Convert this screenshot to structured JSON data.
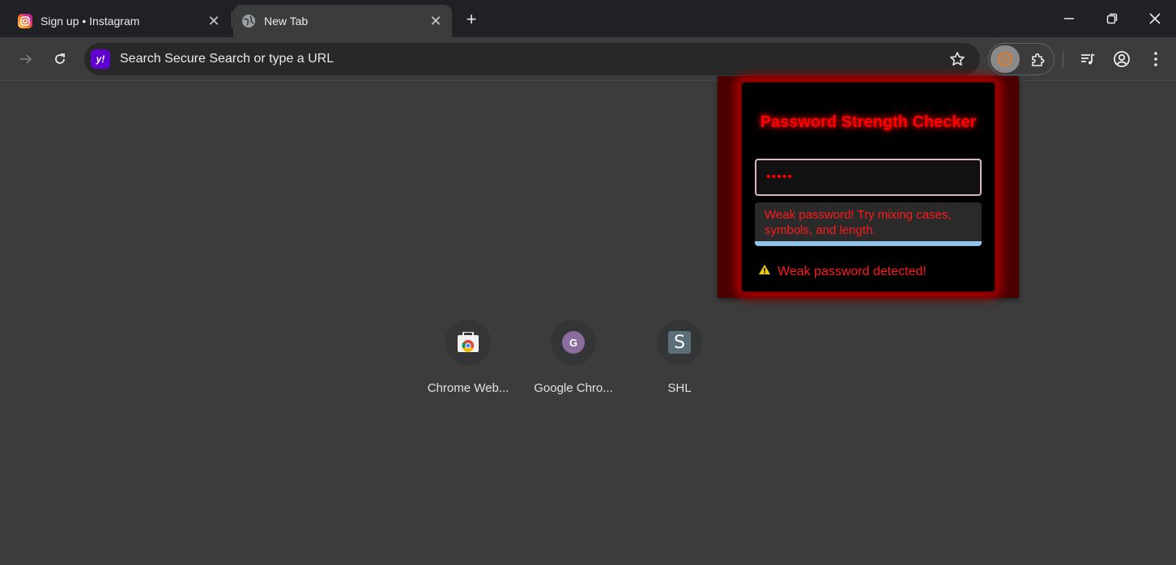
{
  "tabs": [
    {
      "title": "Sign up • Instagram",
      "close": "✕",
      "favicon": "instagram-icon"
    },
    {
      "title": "New Tab",
      "close": "✕",
      "favicon": "globe-icon"
    }
  ],
  "new_tab_symbol": "+",
  "window_controls": {
    "minimize": "minimize-icon",
    "restore": "restore-icon",
    "close": "close-icon"
  },
  "toolbar": {
    "omnibox_placeholder": "Search Secure Search or type a URL",
    "search_engine_logo": "y!"
  },
  "shortcuts": [
    {
      "label": "Chrome Web...",
      "icon": "chrome-web-store-icon"
    },
    {
      "label": "Google Chro...",
      "icon": "letter-g-icon",
      "letter": "G"
    },
    {
      "label": "SHL",
      "icon": "shl-icon",
      "letter": "S"
    }
  ],
  "popup": {
    "title": "Password Strength Checker",
    "password_value": "•••••",
    "feedback": "Weak password! Try mixing cases, symbols, and length.",
    "warning": "Weak password detected!",
    "colors": {
      "accent": "#ff0000",
      "feedback_bar": "#8fc3e8",
      "background": "#000000"
    }
  },
  "theme": {
    "tabstrip_bg": "#202124",
    "page_bg": "#3c3c3c",
    "omnibox_bg": "#282828"
  }
}
